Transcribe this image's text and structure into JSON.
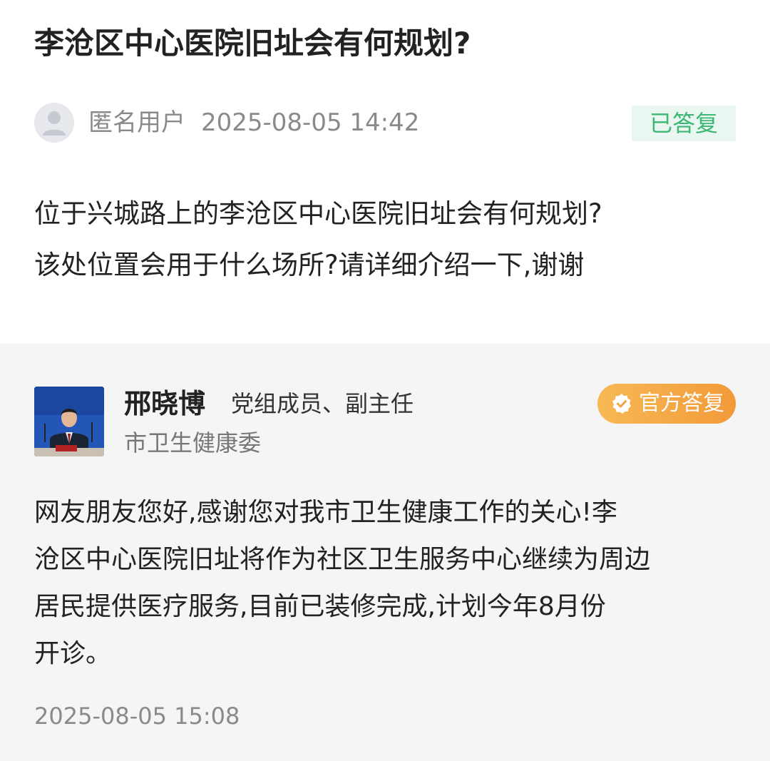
{
  "question": {
    "title": "李沧区中心医院旧址会有何规划?",
    "author": "匿名用户",
    "timestamp": "2025-08-05 14:42",
    "status": "已答复",
    "body_lines": [
      "位于兴城路上的李沧区中心医院旧址会有何规划?",
      "该处位置会用于什么场所?请详细介绍一下,谢谢"
    ]
  },
  "answer": {
    "responder": {
      "name": "邢晓博",
      "role": "党组成员、副主任",
      "department": "市卫生健康委"
    },
    "badge": "官方答复",
    "body_lines": [
      "网友朋友您好,感谢您对我市卫生健康工作的关心!李",
      "沧区中心医院旧址将作为社区卫生服务中心继续为周边",
      "居民提供医疗服务,目前已装修完成,计划今年8月份",
      "开诊。"
    ],
    "timestamp": "2025-08-05 15:08"
  },
  "icons": {
    "anonymous_avatar": "user-silhouette-icon",
    "official_badge": "verified-check-icon"
  },
  "colors": {
    "status_text": "#3cb774",
    "status_bg": "#e9f7f0",
    "official_badge_start": "#f7b955",
    "official_badge_end": "#f29a3a",
    "answer_bg": "#f5f5f5"
  }
}
